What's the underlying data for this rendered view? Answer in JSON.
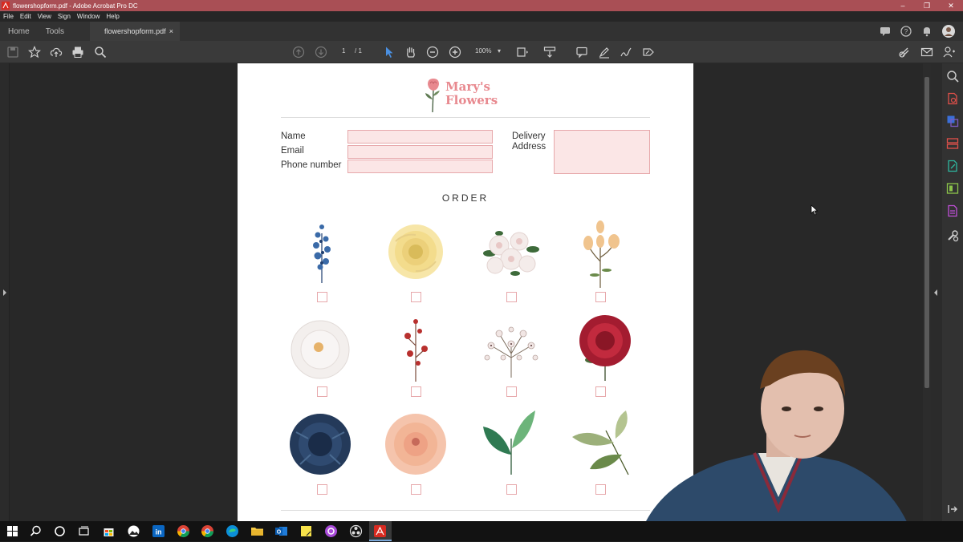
{
  "window": {
    "title": "flowershopform.pdf - Adobe Acrobat Pro DC",
    "minimize": "–",
    "restore": "❐",
    "close": "✕"
  },
  "menu": [
    "File",
    "Edit",
    "View",
    "Sign",
    "Window",
    "Help"
  ],
  "tabs": {
    "home": "Home",
    "tools": "Tools",
    "document": "flowershopform.pdf",
    "document_close": "×"
  },
  "toolbar": {
    "page_current": "1",
    "page_total": "/ 1",
    "zoom": "100%"
  },
  "form": {
    "logo_line1": "Mary's",
    "logo_line2": "Flowers",
    "name_label": "Name",
    "email_label": "Email",
    "phone_label": "Phone number",
    "delivery_label_1": "Delivery",
    "delivery_label_2": "Address",
    "order_heading": "ORDER",
    "field_fill_color": "#fbe6e6",
    "field_border_color": "#e7a8ab",
    "brand_color": "#e8898f"
  },
  "flowers": [
    "blue-sprig",
    "yellow-rose",
    "white-rose-bouquet",
    "peach-buds",
    "white-peony",
    "red-berry-sprig",
    "baby-breath",
    "crimson-peony",
    "navy-dahlia",
    "peach-peony",
    "green-leaves",
    "olive-leaves"
  ],
  "colors": {
    "titlebar": "#a94f55",
    "accent_blue": "#4a90e2"
  }
}
